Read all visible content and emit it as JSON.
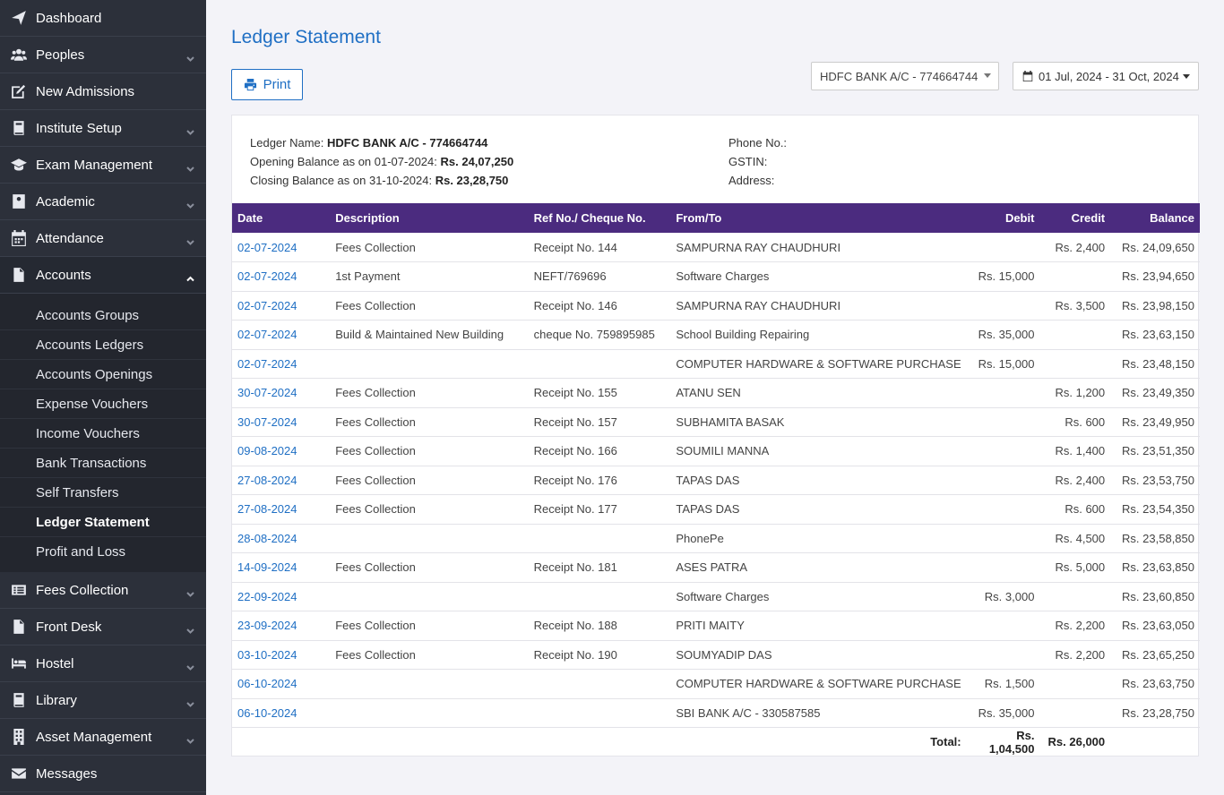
{
  "sidebar": {
    "items": [
      {
        "label": "Dashboard",
        "icon": "paper-plane-icon",
        "chevron": false
      },
      {
        "label": "Peoples",
        "icon": "users-icon",
        "chevron": true
      },
      {
        "label": "New Admissions",
        "icon": "edit-icon",
        "chevron": false
      },
      {
        "label": "Institute Setup",
        "icon": "book-icon",
        "chevron": true
      },
      {
        "label": "Exam Management",
        "icon": "graduation-cap-icon",
        "chevron": true
      },
      {
        "label": "Academic",
        "icon": "id-card-icon",
        "chevron": true
      },
      {
        "label": "Attendance",
        "icon": "calendar-icon",
        "chevron": true
      },
      {
        "label": "Accounts",
        "icon": "file-icon",
        "chevron": true,
        "open": true
      }
    ],
    "submenu": [
      "Accounts Groups",
      "Accounts Ledgers",
      "Accounts Openings",
      "Expense Vouchers",
      "Income Vouchers",
      "Bank Transactions",
      "Self Transfers",
      "Ledger Statement",
      "Profit and Loss"
    ],
    "active_submenu": "Ledger Statement",
    "items_after": [
      {
        "label": "Fees Collection",
        "icon": "money-list-icon",
        "chevron": true
      },
      {
        "label": "Front Desk",
        "icon": "file-icon",
        "chevron": true
      },
      {
        "label": "Hostel",
        "icon": "bed-icon",
        "chevron": true
      },
      {
        "label": "Library",
        "icon": "book-icon",
        "chevron": true
      },
      {
        "label": "Asset Management",
        "icon": "building-icon",
        "chevron": true
      },
      {
        "label": "Messages",
        "icon": "envelope-icon",
        "chevron": false
      }
    ]
  },
  "header": {
    "title": "Ledger Statement",
    "print_label": "Print",
    "ledger_select": "HDFC BANK A/C - 774664744",
    "date_range": "01 Jul, 2024 - 31 Oct, 2024"
  },
  "info": {
    "ledger_name_label": "Ledger Name: ",
    "ledger_name": "HDFC BANK A/C - 774664744",
    "opening_label": "Opening Balance as on 01-07-2024: ",
    "opening_value": "Rs. 24,07,250",
    "closing_label": "Closing Balance as on 31-10-2024: ",
    "closing_value": "Rs. 23,28,750",
    "phone_label": "Phone No.:",
    "gstin_label": "GSTIN:",
    "address_label": "Address:"
  },
  "table": {
    "headers": [
      "Date",
      "Description",
      "Ref No./ Cheque No.",
      "From/To",
      "Debit",
      "Credit",
      "Balance"
    ],
    "rows": [
      [
        "02-07-2024",
        "Fees Collection",
        "Receipt No. 144",
        "SAMPURNA RAY CHAUDHURI",
        "",
        "Rs. 2,400",
        "Rs. 24,09,650"
      ],
      [
        "02-07-2024",
        "1st Payment",
        "NEFT/769696",
        "Software Charges",
        "Rs. 15,000",
        "",
        "Rs. 23,94,650"
      ],
      [
        "02-07-2024",
        "Fees Collection",
        "Receipt No. 146",
        "SAMPURNA RAY CHAUDHURI",
        "",
        "Rs. 3,500",
        "Rs. 23,98,150"
      ],
      [
        "02-07-2024",
        "Build & Maintained New Building",
        "cheque No. 759895985",
        "School Building Repairing",
        "Rs. 35,000",
        "",
        "Rs. 23,63,150"
      ],
      [
        "02-07-2024",
        "",
        "",
        "COMPUTER HARDWARE & SOFTWARE PURCHASE",
        "Rs. 15,000",
        "",
        "Rs. 23,48,150"
      ],
      [
        "30-07-2024",
        "Fees Collection",
        "Receipt No. 155",
        "ATANU SEN",
        "",
        "Rs. 1,200",
        "Rs. 23,49,350"
      ],
      [
        "30-07-2024",
        "Fees Collection",
        "Receipt No. 157",
        "SUBHAMITA BASAK",
        "",
        "Rs. 600",
        "Rs. 23,49,950"
      ],
      [
        "09-08-2024",
        "Fees Collection",
        "Receipt No. 166",
        "SOUMILI MANNA",
        "",
        "Rs. 1,400",
        "Rs. 23,51,350"
      ],
      [
        "27-08-2024",
        "Fees Collection",
        "Receipt No. 176",
        "TAPAS DAS",
        "",
        "Rs. 2,400",
        "Rs. 23,53,750"
      ],
      [
        "27-08-2024",
        "Fees Collection",
        "Receipt No. 177",
        "TAPAS DAS",
        "",
        "Rs. 600",
        "Rs. 23,54,350"
      ],
      [
        "28-08-2024",
        "",
        "",
        "PhonePe",
        "",
        "Rs. 4,500",
        "Rs. 23,58,850"
      ],
      [
        "14-09-2024",
        "Fees Collection",
        "Receipt No. 181",
        "ASES PATRA",
        "",
        "Rs. 5,000",
        "Rs. 23,63,850"
      ],
      [
        "22-09-2024",
        "",
        "",
        "Software Charges",
        "Rs. 3,000",
        "",
        "Rs. 23,60,850"
      ],
      [
        "23-09-2024",
        "Fees Collection",
        "Receipt No. 188",
        "PRITI MAITY",
        "",
        "Rs. 2,200",
        "Rs. 23,63,050"
      ],
      [
        "03-10-2024",
        "Fees Collection",
        "Receipt No. 190",
        "SOUMYADIP DAS",
        "",
        "Rs. 2,200",
        "Rs. 23,65,250"
      ],
      [
        "06-10-2024",
        "",
        "",
        "COMPUTER HARDWARE & SOFTWARE PURCHASE",
        "Rs. 1,500",
        "",
        "Rs. 23,63,750"
      ],
      [
        "06-10-2024",
        "",
        "",
        "SBI BANK A/C - 330587585",
        "Rs. 35,000",
        "",
        "Rs. 23,28,750"
      ]
    ],
    "total_label": "Total:",
    "total_debit": "Rs. 1,04,500",
    "total_credit": "Rs. 26,000"
  },
  "colors": {
    "sidebar_bg": "#2c303a",
    "accent": "#1f6fc4",
    "table_header": "#4b2b7f"
  }
}
